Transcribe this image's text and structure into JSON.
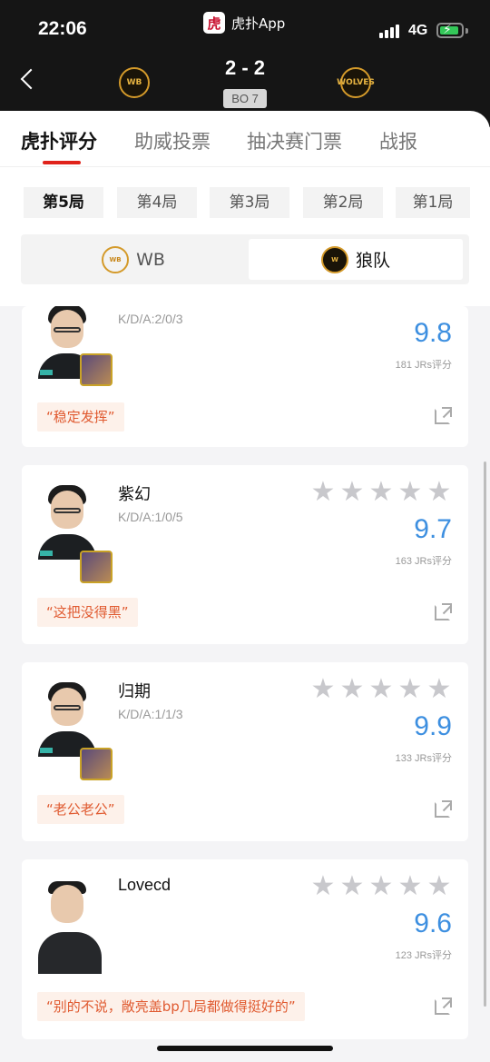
{
  "status_bar": {
    "time": "22:06",
    "app_name": "虎扑App",
    "app_icon": "虎",
    "network": "4G"
  },
  "match": {
    "score": "2 - 2",
    "format": "BO 7",
    "home_logo": "WB",
    "away_logo": "WOLVES"
  },
  "tabs": [
    {
      "label": "虎扑评分",
      "active": true
    },
    {
      "label": "助威投票"
    },
    {
      "label": "抽决赛门票"
    },
    {
      "label": "战报"
    }
  ],
  "games": [
    {
      "label": "第5局",
      "active": true
    },
    {
      "label": "第4局"
    },
    {
      "label": "第3局"
    },
    {
      "label": "第2局"
    },
    {
      "label": "第1局"
    }
  ],
  "teams": [
    {
      "label": "WB",
      "logo": "WB"
    },
    {
      "label": "狼队",
      "logo": "W",
      "active": true
    }
  ],
  "players": [
    {
      "name": "",
      "kda": "K/D/A:2/0/3",
      "rating": "9.8",
      "votes": "181 JRs评分",
      "quote": "“稳定发挥”"
    },
    {
      "name": "紫幻",
      "kda": "K/D/A:1/0/5",
      "rating": "9.7",
      "votes": "163 JRs评分",
      "quote": "“这把没得黑”"
    },
    {
      "name": "归期",
      "kda": "K/D/A:1/1/3",
      "rating": "9.9",
      "votes": "133 JRs评分",
      "quote": "“老公老公”"
    },
    {
      "name": "Lovecd",
      "kda": "",
      "rating": "9.6",
      "votes": "123 JRs评分",
      "quote": "“别的不说，敞亮盖bp几局都做得挺好的”"
    }
  ],
  "colors": {
    "accent": "#e0231b",
    "rating": "#3d8fe0",
    "quote_text": "#e05a30",
    "quote_bg": "#fdf1ea"
  }
}
